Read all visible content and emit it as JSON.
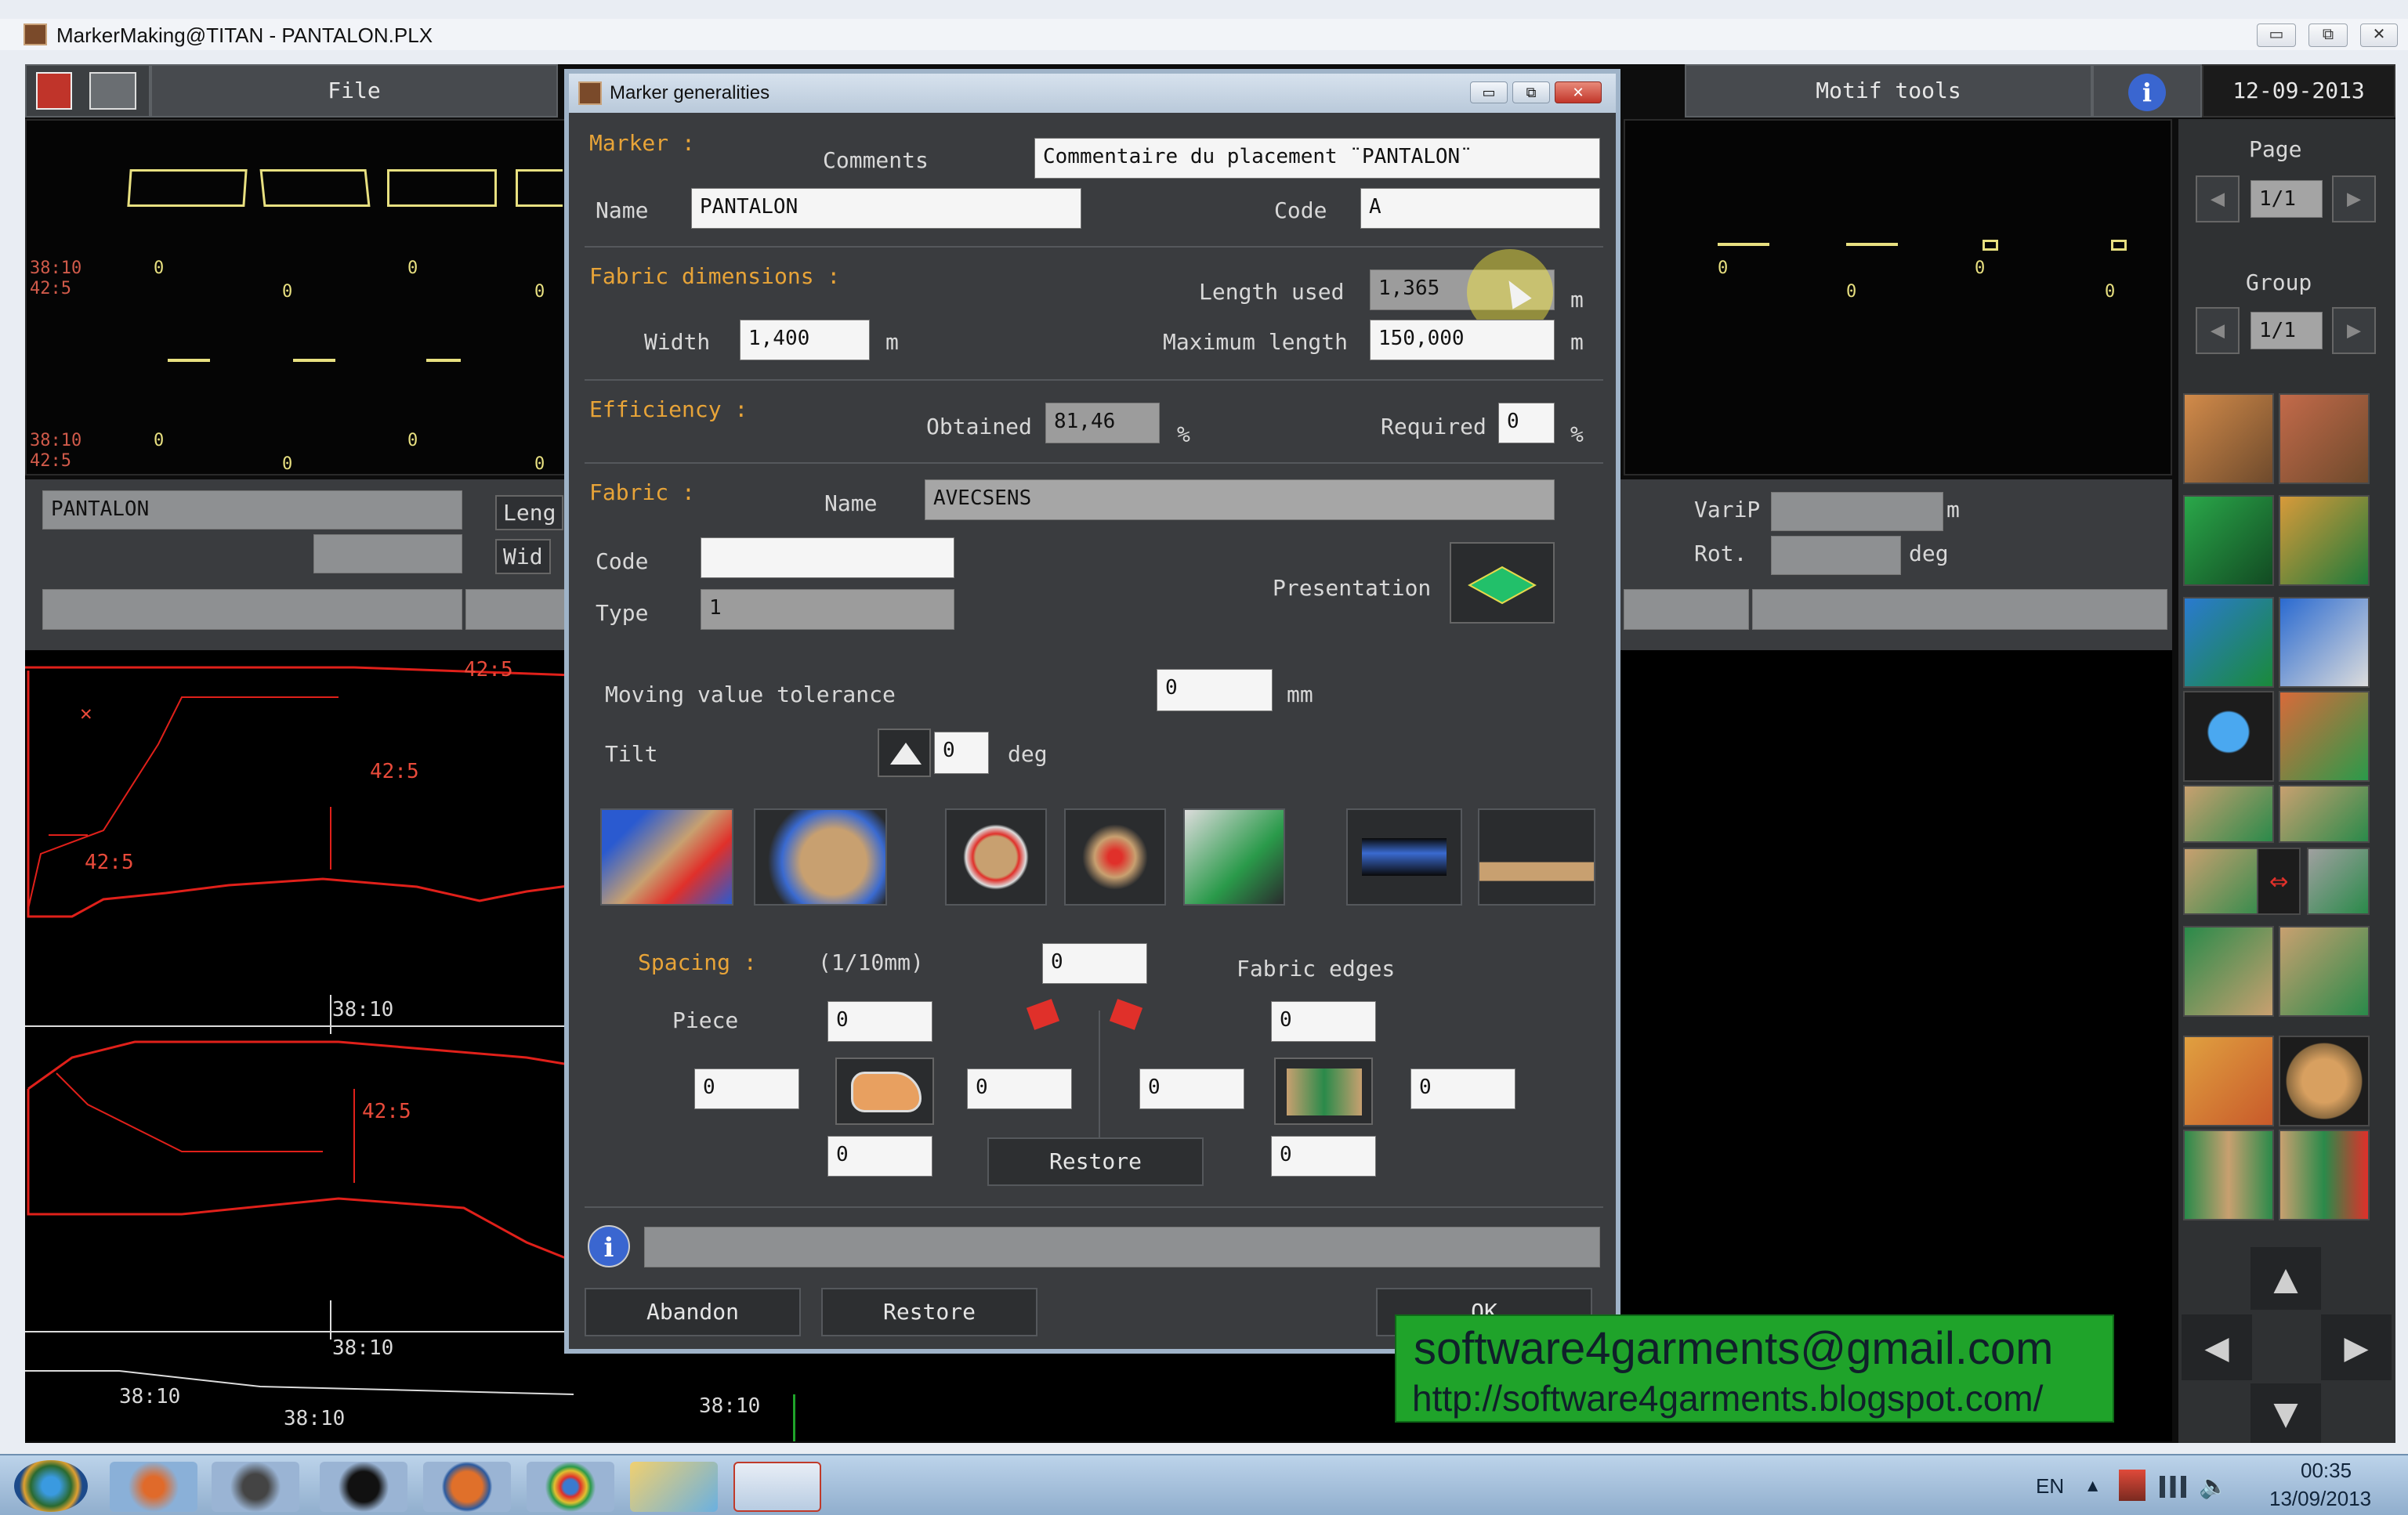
{
  "window": {
    "title": "MarkerMaking@TITAN - PANTALON.PLX",
    "buttons": {
      "minimize": "▭",
      "restore": "⧉",
      "close": "✕"
    }
  },
  "menubar": {
    "file": "File",
    "motif_tools": "Motif tools",
    "date": "12-09-2013"
  },
  "right_panel": {
    "page_label": "Page",
    "page_value": "1/1",
    "group_label": "Group",
    "group_value": "1/1"
  },
  "left_preview": {
    "labels": [
      "38:10",
      "42:5",
      "38:10",
      "42:5"
    ],
    "zeros": [
      "0",
      "0",
      "0",
      "0",
      "0",
      "0",
      "0",
      "0",
      "0",
      "0"
    ]
  },
  "right_preview": {
    "zeros": [
      "0",
      "0",
      "0",
      "0"
    ]
  },
  "info_bar": {
    "marker_name": "PANTALON",
    "leng_label": "Leng",
    "wid_label": "Wid",
    "varip_label": "VariP",
    "varip_unit": "m",
    "rot_label": "Rot.",
    "rot_unit": "deg"
  },
  "canvas_labels": {
    "size_a": "38:10",
    "size_b": "42:5",
    "size_c": "42:5",
    "size_d": "42:5",
    "size_e": "42:5",
    "size_f": "38:10",
    "size_g": "38:10",
    "size_h": "38:10",
    "size_i": "38:10",
    "size_j": "38:10",
    "x_mark": "✕"
  },
  "dialog": {
    "title": "Marker generalities",
    "marker_section": "Marker :",
    "comments_label": "Comments",
    "comments_value": "Commentaire du placement ¨PANTALON¨",
    "name_label": "Name",
    "name_value": "PANTALON",
    "code_label": "Code",
    "code_value": "A",
    "fabric_dims_section": "Fabric dimensions :",
    "length_used_label": "Length used",
    "length_used_value": "1,365",
    "length_used_unit": "m",
    "width_label": "Width",
    "width_value": "1,400",
    "width_unit": "m",
    "max_length_label": "Maximum length",
    "max_length_value": "150,000",
    "max_length_unit": "m",
    "efficiency_section": "Efficiency :",
    "obtained_label": "Obtained",
    "obtained_value": "81,46",
    "obtained_unit": "%",
    "required_label": "Required",
    "required_value": "0",
    "required_unit": "%",
    "fabric_section": "Fabric :",
    "fabric_name_label": "Name",
    "fabric_name_value": "AVECSENS",
    "fabric_code_label": "Code",
    "fabric_code_value": "",
    "fabric_type_label": "Type",
    "fabric_type_value": "1",
    "presentation_label": "Presentation",
    "moving_tol_label": "Moving value tolerance",
    "moving_tol_value": "0",
    "moving_tol_unit": "mm",
    "tilt_label": "Tilt",
    "tilt_value": "0",
    "tilt_unit": "deg",
    "spacing_label": "Spacing :",
    "spacing_unit": "(1/10mm)",
    "spacing_value": "0",
    "fabric_edges_label": "Fabric edges",
    "piece_label": "Piece",
    "piece_top": "0",
    "piece_left": "0",
    "piece_right": "0",
    "piece_bottom": "0",
    "edges_top": "0",
    "edges_left": "0",
    "edges_right": "0",
    "edges_bottom": "0",
    "restore_inner": "Restore",
    "status_text": "",
    "abandon_btn": "Abandon",
    "restore_btn": "Restore",
    "ok_btn": "OK"
  },
  "watermark": {
    "email": "software4garments@gmail.com",
    "url": "http://software4garments.blogspot.com/"
  },
  "taskbar": {
    "lang": "EN",
    "time": "00:35",
    "date": "13/09/2013"
  },
  "colors": {
    "accent_orange": "#e8a438",
    "pattern_red": "#e0201a",
    "pattern_yellow": "#e8e080",
    "presentation_green": "#22c06a",
    "watermark_green": "#1fa32a"
  }
}
